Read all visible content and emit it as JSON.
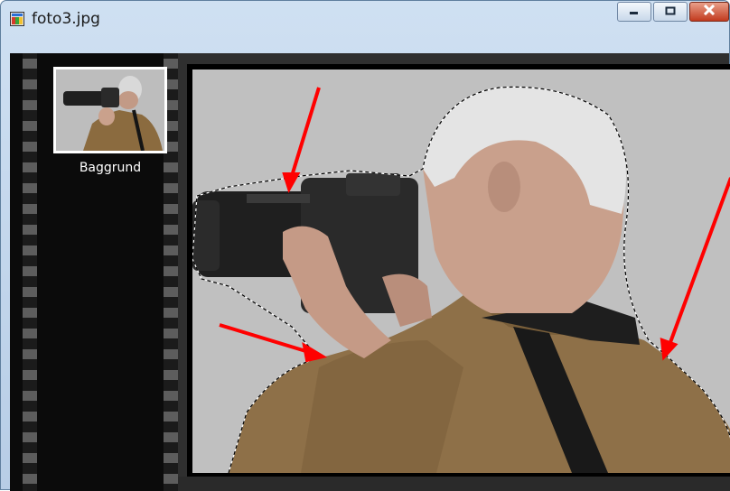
{
  "window": {
    "title": "foto3.jpg",
    "icon": "image-file-icon"
  },
  "controls": {
    "minimize": "minimize-icon",
    "maximize": "maximize-icon",
    "close": "close-icon"
  },
  "layers": [
    {
      "label": "Baggrund",
      "thumbnail": "layer-thumbnail"
    }
  ],
  "canvas": {
    "background_color": "#c0c0c0",
    "selection": "marching-ants outline around person",
    "annotation_color": "#ff0000"
  }
}
